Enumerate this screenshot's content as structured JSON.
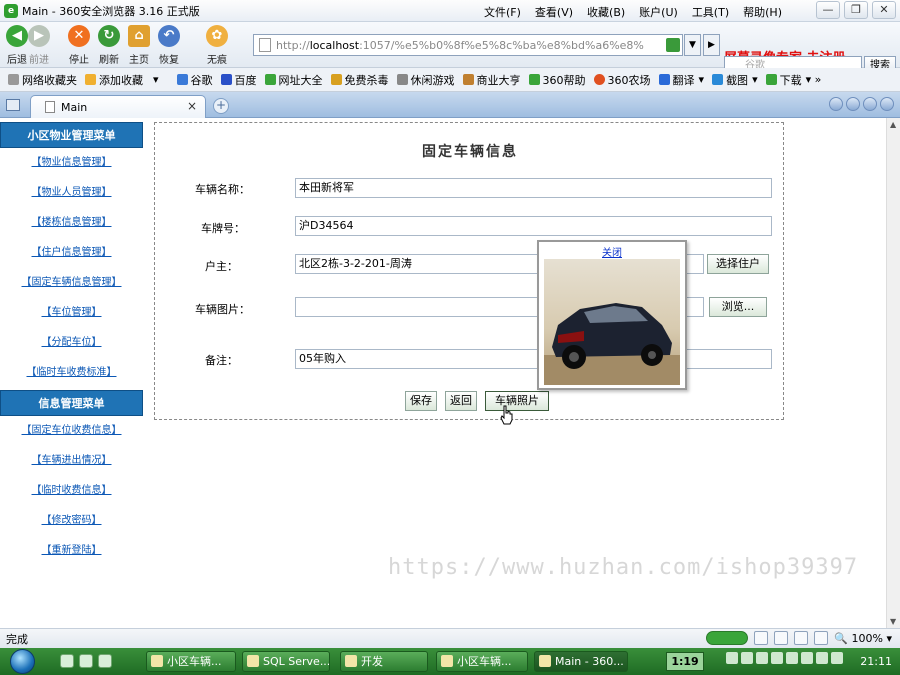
{
  "window": {
    "title": "Main - 360安全浏览器 3.16 正式版",
    "menus": [
      "文件(F)",
      "查看(V)",
      "收藏(B)",
      "账户(U)",
      "工具(T)",
      "帮助(H)"
    ],
    "controls": {
      "minimize": "—",
      "maximize": "❐",
      "close": "✕"
    }
  },
  "toolbar": {
    "back": "后退",
    "forward": "前进",
    "stop": "停止",
    "refresh": "刷新",
    "home": "主页",
    "restore": "恢复",
    "incognito": "无痕",
    "address_prefix": "http://",
    "address_host": "localhost",
    "address_rest": ":1057/%e5%b0%8f%e5%8c%ba%e8%bd%a6%e8%",
    "watermark": "屏幕录像专家 未注册",
    "search_placeholder": "谷歌",
    "search_button": "搜索"
  },
  "favorites": [
    "网络收藏夹",
    "添加收藏",
    "谷歌",
    "百度",
    "网址大全",
    "免费杀毒",
    "休闲游戏",
    "商业大亨",
    "360帮助",
    "360农场",
    "翻译",
    "截图",
    "下载"
  ],
  "tab": {
    "label": "Main"
  },
  "sidebar": {
    "group1": {
      "title": "小区物业管理菜单",
      "items": [
        "【物业信息管理】",
        "【物业人员管理】",
        "【楼栋信息管理】",
        "【住户信息管理】",
        "【固定车辆信息管理】",
        "【车位管理】",
        "【分配车位】",
        "【临时车收费标准】"
      ]
    },
    "group2": {
      "title": "信息管理菜单",
      "items": [
        "【固定车位收费信息】",
        "【车辆进出情况】",
        "【临时收费信息】",
        "【修改密码】",
        "【重新登陆】"
      ]
    }
  },
  "form": {
    "title": "固定车辆信息",
    "fields": {
      "name_label": "车辆名称：",
      "name_value": "本田新将军",
      "plate_label": "车牌号：",
      "plate_value": "沪D34564",
      "owner_label": "户主：",
      "owner_value": "北区2栋-3-2-201-周涛",
      "select_owner_button": "选择住户",
      "image_label": "车辆图片：",
      "browse_button": "浏览...",
      "remark_label": "备注：",
      "remark_value": "05年购入"
    },
    "buttons": {
      "save": "保存",
      "back": "返回",
      "photo": "车辆照片"
    },
    "popup": {
      "close": "关闭"
    }
  },
  "page_watermark": "https://www.huzhan.com/ishop39397",
  "statusbar": {
    "text": "完成",
    "zoom": "100%"
  },
  "taskbar": {
    "tasks": [
      "小区车辆...",
      "SQL Serve...",
      "开发",
      "小区车辆...",
      "Main - 360..."
    ],
    "recording_time": "1:19",
    "clock": "21:11"
  },
  "colors": {
    "menu_head": "#1f73b5",
    "menu_link": "#0b57b5",
    "red_watermark": "#e01010"
  }
}
